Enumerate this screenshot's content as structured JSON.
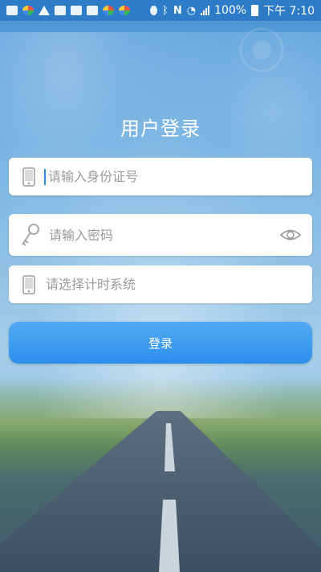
{
  "status_bar": {
    "battery": "100%",
    "time": "下午 7:10"
  },
  "login": {
    "title": "用户登录",
    "id_placeholder": "请输入身份证号",
    "password_placeholder": "请输入密码",
    "system_placeholder": "请选择计时系统",
    "login_button": "登录"
  },
  "icons": {
    "id_field": "phone-icon",
    "password_field": "key-icon",
    "password_toggle": "eye-icon",
    "system_field": "phone-icon"
  },
  "colors": {
    "accent": "#3a9bf0",
    "status_bar": "#2e7cc7",
    "placeholder": "#9a9a9a"
  }
}
